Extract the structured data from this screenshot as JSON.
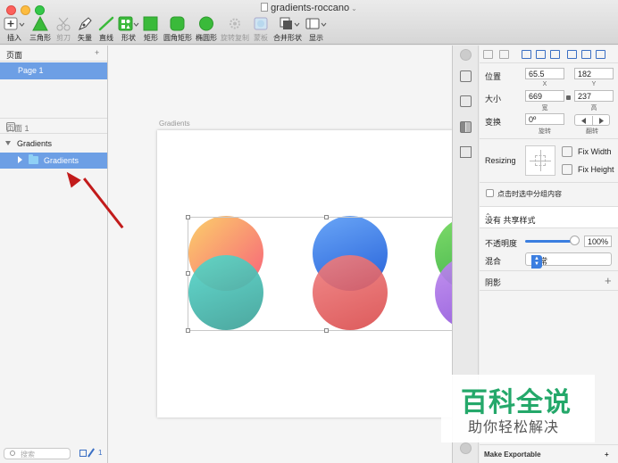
{
  "window": {
    "title": "gradients-roccano"
  },
  "toolbar": {
    "items": [
      {
        "label": "插入",
        "icon": "plus-icon"
      },
      {
        "label": "三角形",
        "icon": "triangle-icon"
      },
      {
        "label": "剪刀",
        "icon": "scissors-icon"
      },
      {
        "label": "矢量",
        "icon": "pen-icon"
      },
      {
        "label": "直线",
        "icon": "line-icon"
      },
      {
        "label": "形状",
        "icon": "shapes-icon"
      },
      {
        "label": "矩形",
        "icon": "rectangle-icon"
      },
      {
        "label": "圆角矩形",
        "icon": "rounded-rectangle-icon"
      },
      {
        "label": "椭圆形",
        "icon": "oval-icon"
      },
      {
        "label": "旋转复制",
        "icon": "rotate-copy-icon"
      },
      {
        "label": "蒙板",
        "icon": "mask-icon"
      },
      {
        "label": "合并形状",
        "icon": "combine-shape-icon"
      },
      {
        "label": "显示",
        "icon": "view-icon"
      }
    ],
    "accent_color": "#3aba3a"
  },
  "sidebar": {
    "pages_header": "页面",
    "pages": [
      "Page 1"
    ],
    "layers_header": "页面 1",
    "artboard_layer": "Gradients",
    "group_layer": "Gradients",
    "search_placeholder": "搜索",
    "filter_count": "1",
    "selection_color": "#6d9fe5"
  },
  "canvas": {
    "artboard_label": "Gradients"
  },
  "inspector": {
    "position_label": "位置",
    "x_value": "65.5",
    "y_value": "182",
    "x_sub": "X",
    "y_sub": "Y",
    "size_label": "大小",
    "width_value": "669",
    "height_value": "237",
    "width_sub": "宽",
    "height_sub": "高",
    "transform_label": "变换",
    "rotation_value": "0º",
    "rotation_sub": "旋转",
    "flip_sub": "翻转",
    "resizing_label": "Resizing",
    "fix_width": "Fix Width",
    "fix_height": "Fix Height",
    "click_through": "点击时选中分组内容",
    "shared_style": "没有 共享样式",
    "opacity_label": "不透明度",
    "opacity_value": "100%",
    "opacity_fraction": 1.0,
    "blend_label": "混合",
    "blend_value": "正常",
    "shadows_label": "阴影",
    "make_exportable": "Make Exportable"
  },
  "watermark": {
    "title": "百科全说",
    "subtitle": "助你轻松解决"
  }
}
